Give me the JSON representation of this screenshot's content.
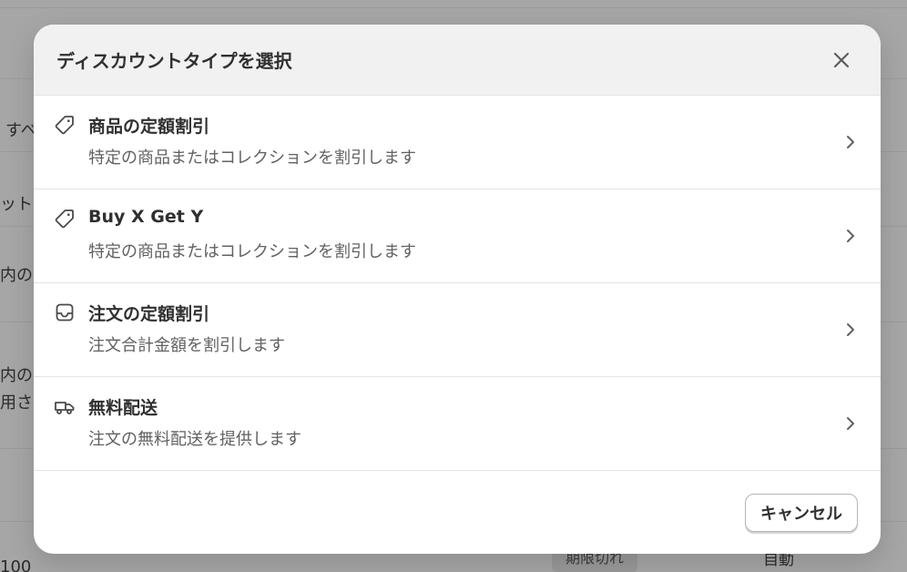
{
  "background": {
    "row_fragments": [
      "すべ",
      "ット",
      "内の",
      "内の",
      "用さ",
      "100"
    ],
    "status_badge": "期限切れ",
    "method_text": "自動"
  },
  "modal": {
    "title": "ディスカウントタイプを選択",
    "close_icon": "close-icon",
    "options": [
      {
        "icon": "tag-icon",
        "title": "商品の定額割引",
        "description": "特定の商品またはコレクションを割引します"
      },
      {
        "icon": "tag-icon",
        "title": "Buy X Get Y",
        "description": "特定の商品またはコレクションを割引します"
      },
      {
        "icon": "inbox-icon",
        "title": "注文の定額割引",
        "description": "注文合計金額を割引します"
      },
      {
        "icon": "truck-icon",
        "title": "無料配送",
        "description": "注文の無料配送を提供します"
      }
    ],
    "cancel_label": "キャンセル"
  }
}
